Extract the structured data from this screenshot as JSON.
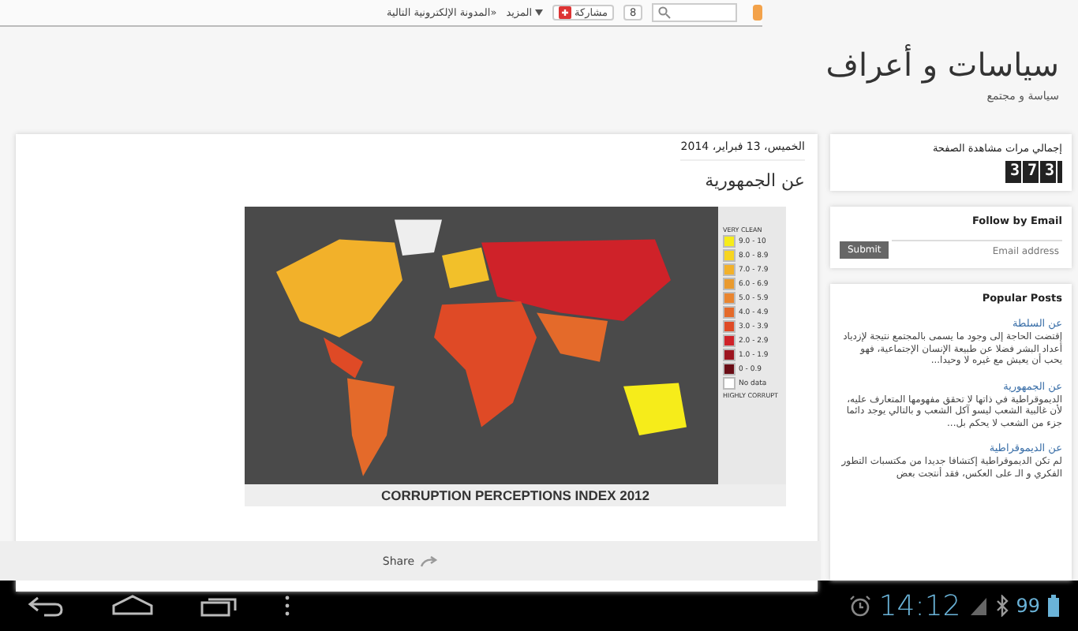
{
  "navbar": {
    "share_label": "مشاركة",
    "plus_count": "8",
    "more": "المزيد",
    "next_blog": "المدونة الإلكترونية التالية»"
  },
  "header": {
    "title": "سياسات و أعراف",
    "description": "سياسة و مجتمع"
  },
  "post": {
    "date": "الخميس، 13 فبراير، 2014",
    "title": "عن الجمهورية",
    "figure": {
      "legend_top": "VERY CLEAN",
      "legend_bottom": "HIGHLY CORRUPT",
      "title": "CORRUPTION PERCEPTIONS INDEX 2012",
      "legend": [
        {
          "label": "9.0 - 10",
          "color": "#f6ec1a"
        },
        {
          "label": "8.0 - 8.9",
          "color": "#f7d520"
        },
        {
          "label": "7.0 - 7.9",
          "color": "#f2b12a"
        },
        {
          "label": "6.0 - 6.9",
          "color": "#e99a2e"
        },
        {
          "label": "5.0 - 5.9",
          "color": "#e9852f"
        },
        {
          "label": "4.0 - 4.9",
          "color": "#e46a2a"
        },
        {
          "label": "3.0 - 3.9",
          "color": "#df4a26"
        },
        {
          "label": "2.0 - 2.9",
          "color": "#cf2229"
        },
        {
          "label": "1.0 - 1.9",
          "color": "#9d1520"
        },
        {
          "label": "0 - 0.9",
          "color": "#6a0d16"
        },
        {
          "label": "No data",
          "color": "#ffffff"
        }
      ]
    }
  },
  "share": {
    "label": "Share"
  },
  "sidebar": {
    "counter": {
      "title": "إجمالي مرات مشاهدة الصفحة",
      "value": "373"
    },
    "follow": {
      "title": "Follow by Email",
      "placeholder": "Email address",
      "button": "Submit"
    },
    "popular": {
      "title": "Popular Posts",
      "posts": [
        {
          "title": "عن السلطة",
          "snippet": "إقتضت الحاجة إلى وجود ما يسمى بالمجتمع نتيجة لإزدياد أعداد البشر فضلا عن طبيعة الإنسان الإجتماعية، فهو يحب أن يعيش مع غيره لا وحيدا..."
        },
        {
          "title": "عن الجمهورية",
          "snippet": "الديموقراطية في ذاتها لا تحقق مفهومها المتعارف عليه، لأن غالبية الشعب ليسو آكل الشعب و بالتالي يوجد دائما جزء من الشعب لا يحكم بل..."
        },
        {
          "title": "عن الديموقراطية",
          "snippet": "لم تكن الديموقراطية إكتشافا جديدا من مكتسبات التطور الفكري و الـ على العكس، فقد أنتجت بعض"
        }
      ]
    }
  },
  "system_bar": {
    "time": "14:12",
    "battery": "99"
  }
}
